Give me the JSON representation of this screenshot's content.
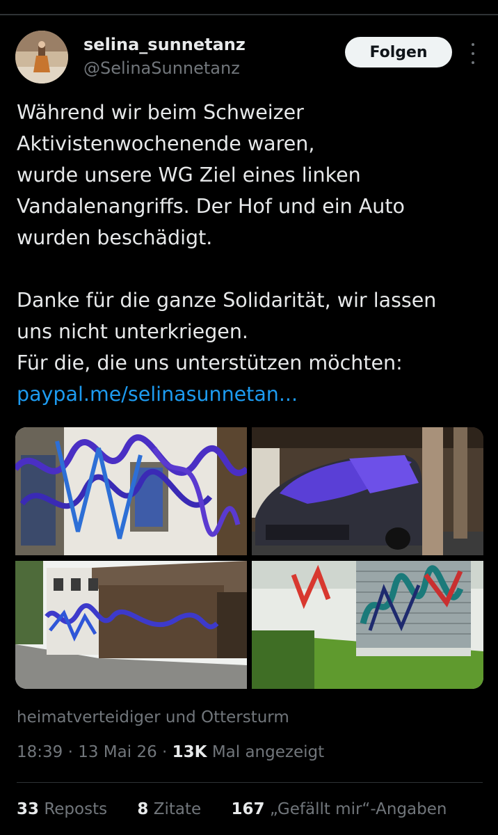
{
  "author": {
    "display_name": "selina_sunnetanz",
    "handle": "@SelinaSunnetanz"
  },
  "follow_label": "Folgen",
  "tweet": {
    "lines": [
      "Während wir beim Schweizer",
      "Aktivistenwochenende waren,",
      "wurde unsere WG Ziel eines linken",
      "Vandalenangriffs. Der Hof und ein Auto",
      "wurden beschädigt.",
      "",
      "Danke für die ganze Solidarität, wir lassen",
      "uns nicht unterkriegen.",
      "Für die, die uns unterstützen möchten:"
    ],
    "link": "paypal.me/selinasunnetan..."
  },
  "photos": [
    {
      "alt": "graffiti-wall-windows"
    },
    {
      "alt": "painted-car-garage"
    },
    {
      "alt": "graffiti-farmhouse"
    },
    {
      "alt": "graffiti-heat-pump"
    }
  ],
  "tagged": "heimatverteidiger und Ottersturm",
  "meta": {
    "time": "18:39",
    "sep1": "·",
    "date": "13 Mai 26",
    "sep2": "·",
    "views_count": "13K",
    "views_label": "Mal angezeigt"
  },
  "stats": {
    "reposts_count": "33",
    "reposts_label": "Reposts",
    "quotes_count": "8",
    "quotes_label": "Zitate",
    "likes_count": "167",
    "likes_label": "„Gefällt mir“-Angaben"
  },
  "colors": {
    "background": "#000000",
    "text": "#e7e9ea",
    "secondary": "#71767b",
    "link": "#1d9bf0",
    "graffiti": "#4a2fc4"
  }
}
